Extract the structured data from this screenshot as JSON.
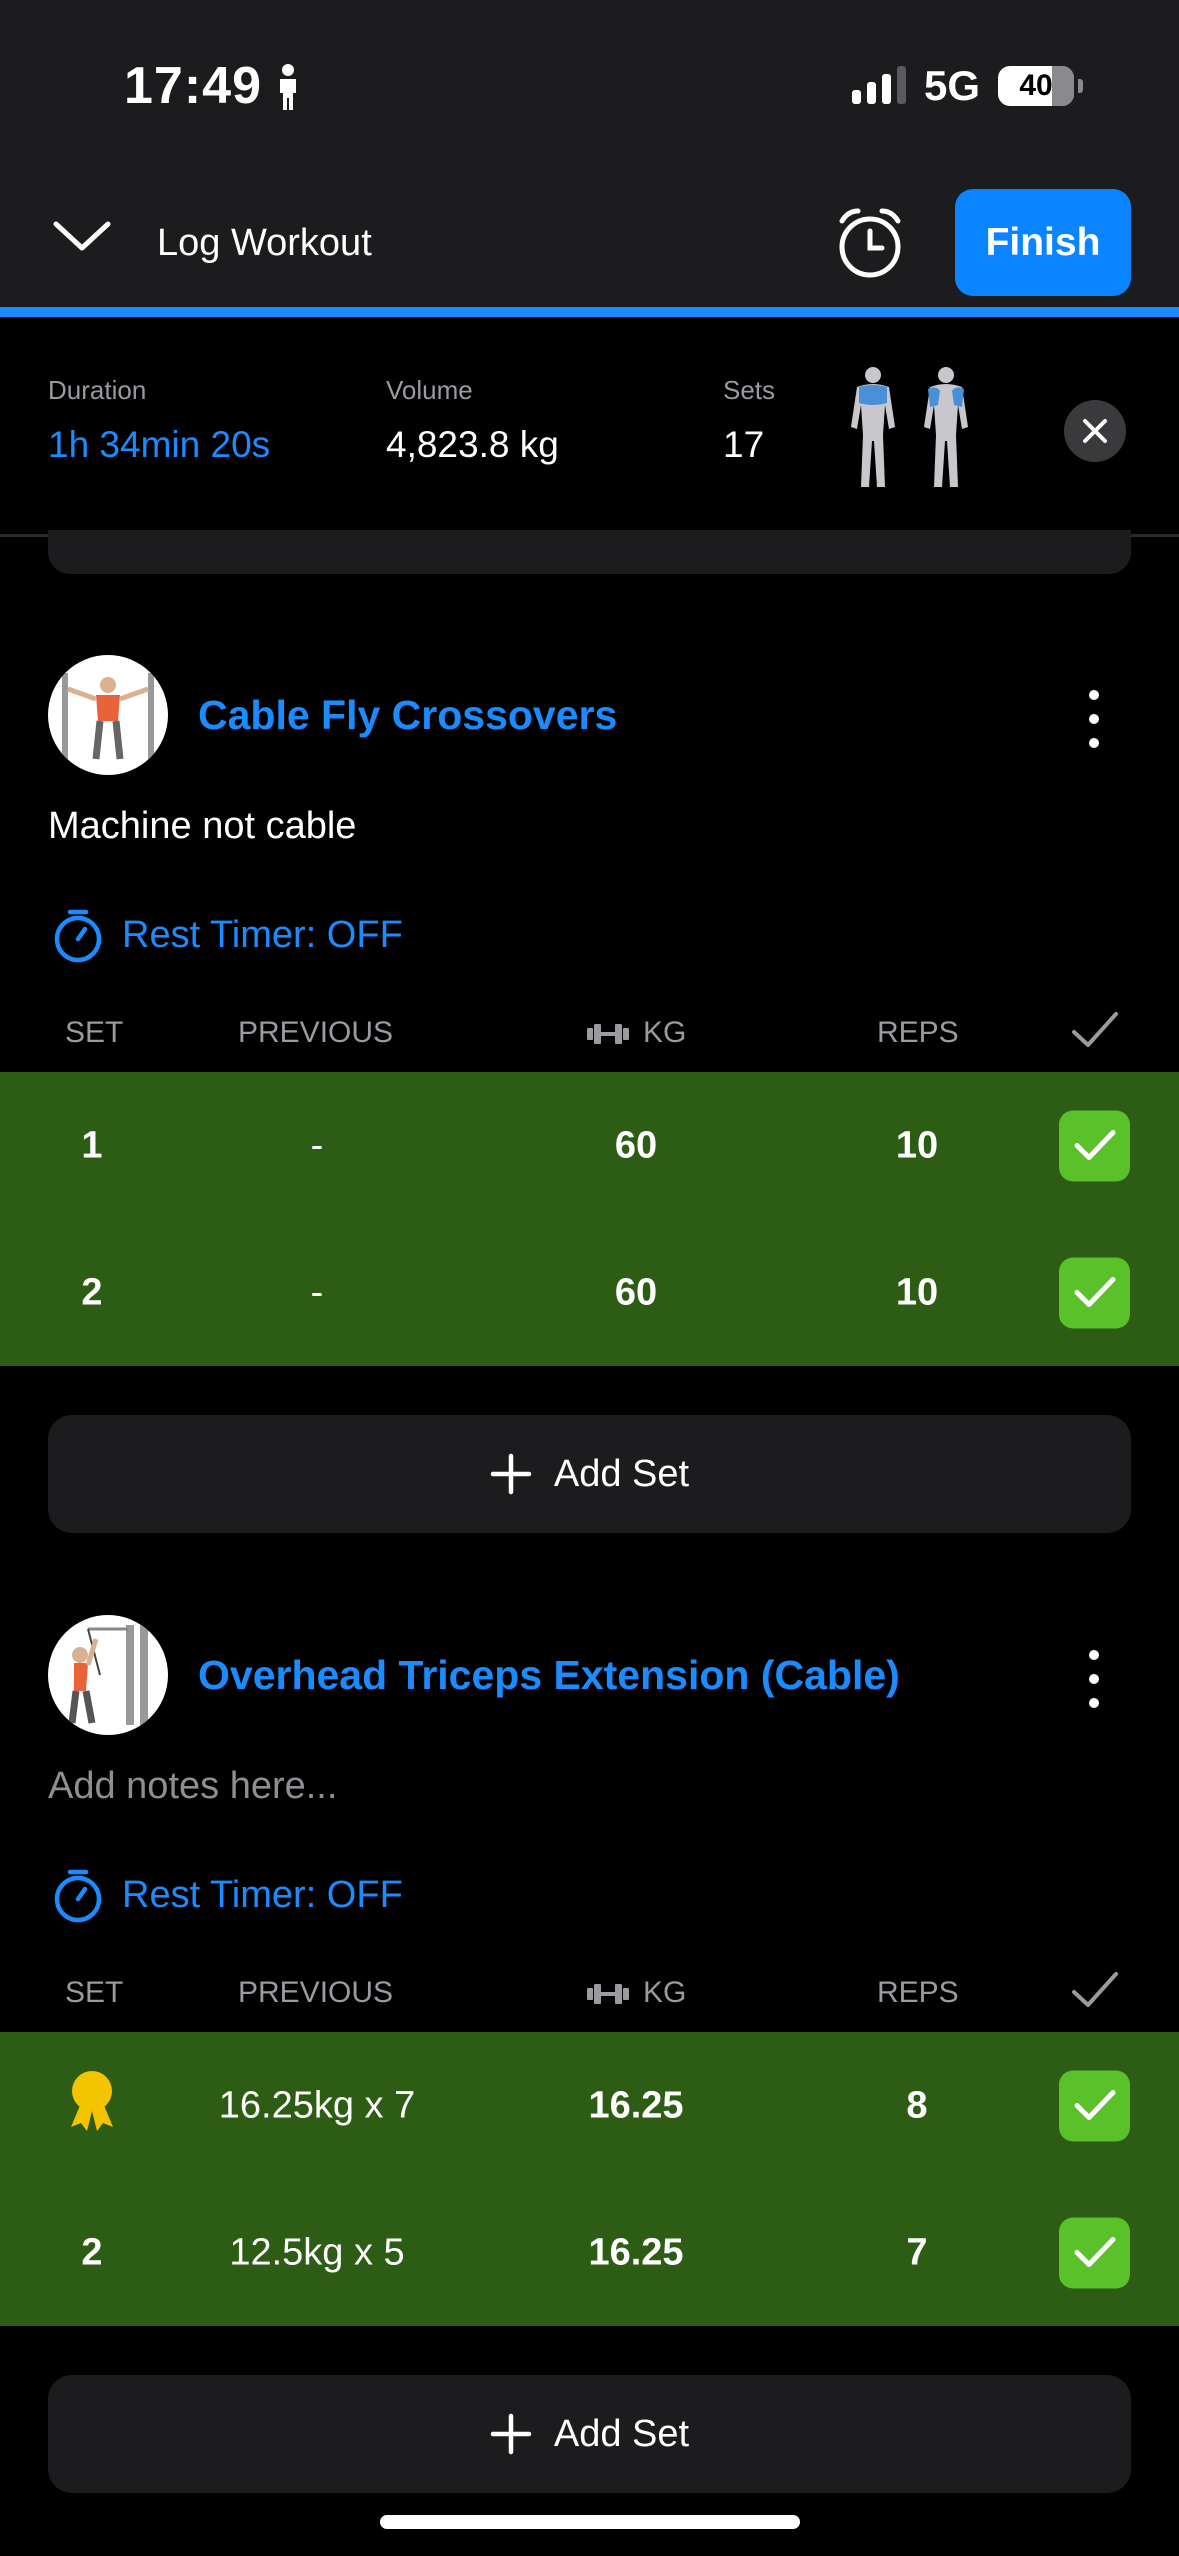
{
  "status_bar": {
    "time": "17:49",
    "network": "5G",
    "battery": "40"
  },
  "header": {
    "title": "Log Workout",
    "finish_label": "Finish"
  },
  "summary": {
    "duration_label": "Duration",
    "duration_value": "1h 34min 20s",
    "volume_label": "Volume",
    "volume_value": "4,823.8 kg",
    "sets_label": "Sets",
    "sets_value": "17"
  },
  "columns": {
    "set": "SET",
    "previous": "PREVIOUS",
    "kg": "KG",
    "reps": "REPS"
  },
  "exercises": [
    {
      "name": "Cable Fly Crossovers",
      "note": "Machine not cable",
      "rest_timer": "Rest Timer: OFF",
      "sets": [
        {
          "set": "1",
          "previous": "-",
          "kg": "60",
          "reps": "10",
          "completed": true
        },
        {
          "set": "2",
          "previous": "-",
          "kg": "60",
          "reps": "10",
          "completed": true
        }
      ],
      "add_set_label": "Add Set"
    },
    {
      "name": "Overhead Triceps Extension (Cable)",
      "note_placeholder": "Add notes here...",
      "rest_timer": "Rest Timer: OFF",
      "sets": [
        {
          "set_icon": "medal-icon",
          "previous": "16.25kg x 7",
          "kg": "16.25",
          "reps": "8",
          "completed": true
        },
        {
          "set": "2",
          "previous": "12.5kg x 5",
          "kg": "16.25",
          "reps": "7",
          "completed": true
        }
      ],
      "add_set_label": "Add Set"
    }
  ],
  "colors": {
    "accent": "#0a84ff",
    "completed_row": "#2d5c14",
    "check": "#5ac12a",
    "medal": "#f5c400"
  }
}
